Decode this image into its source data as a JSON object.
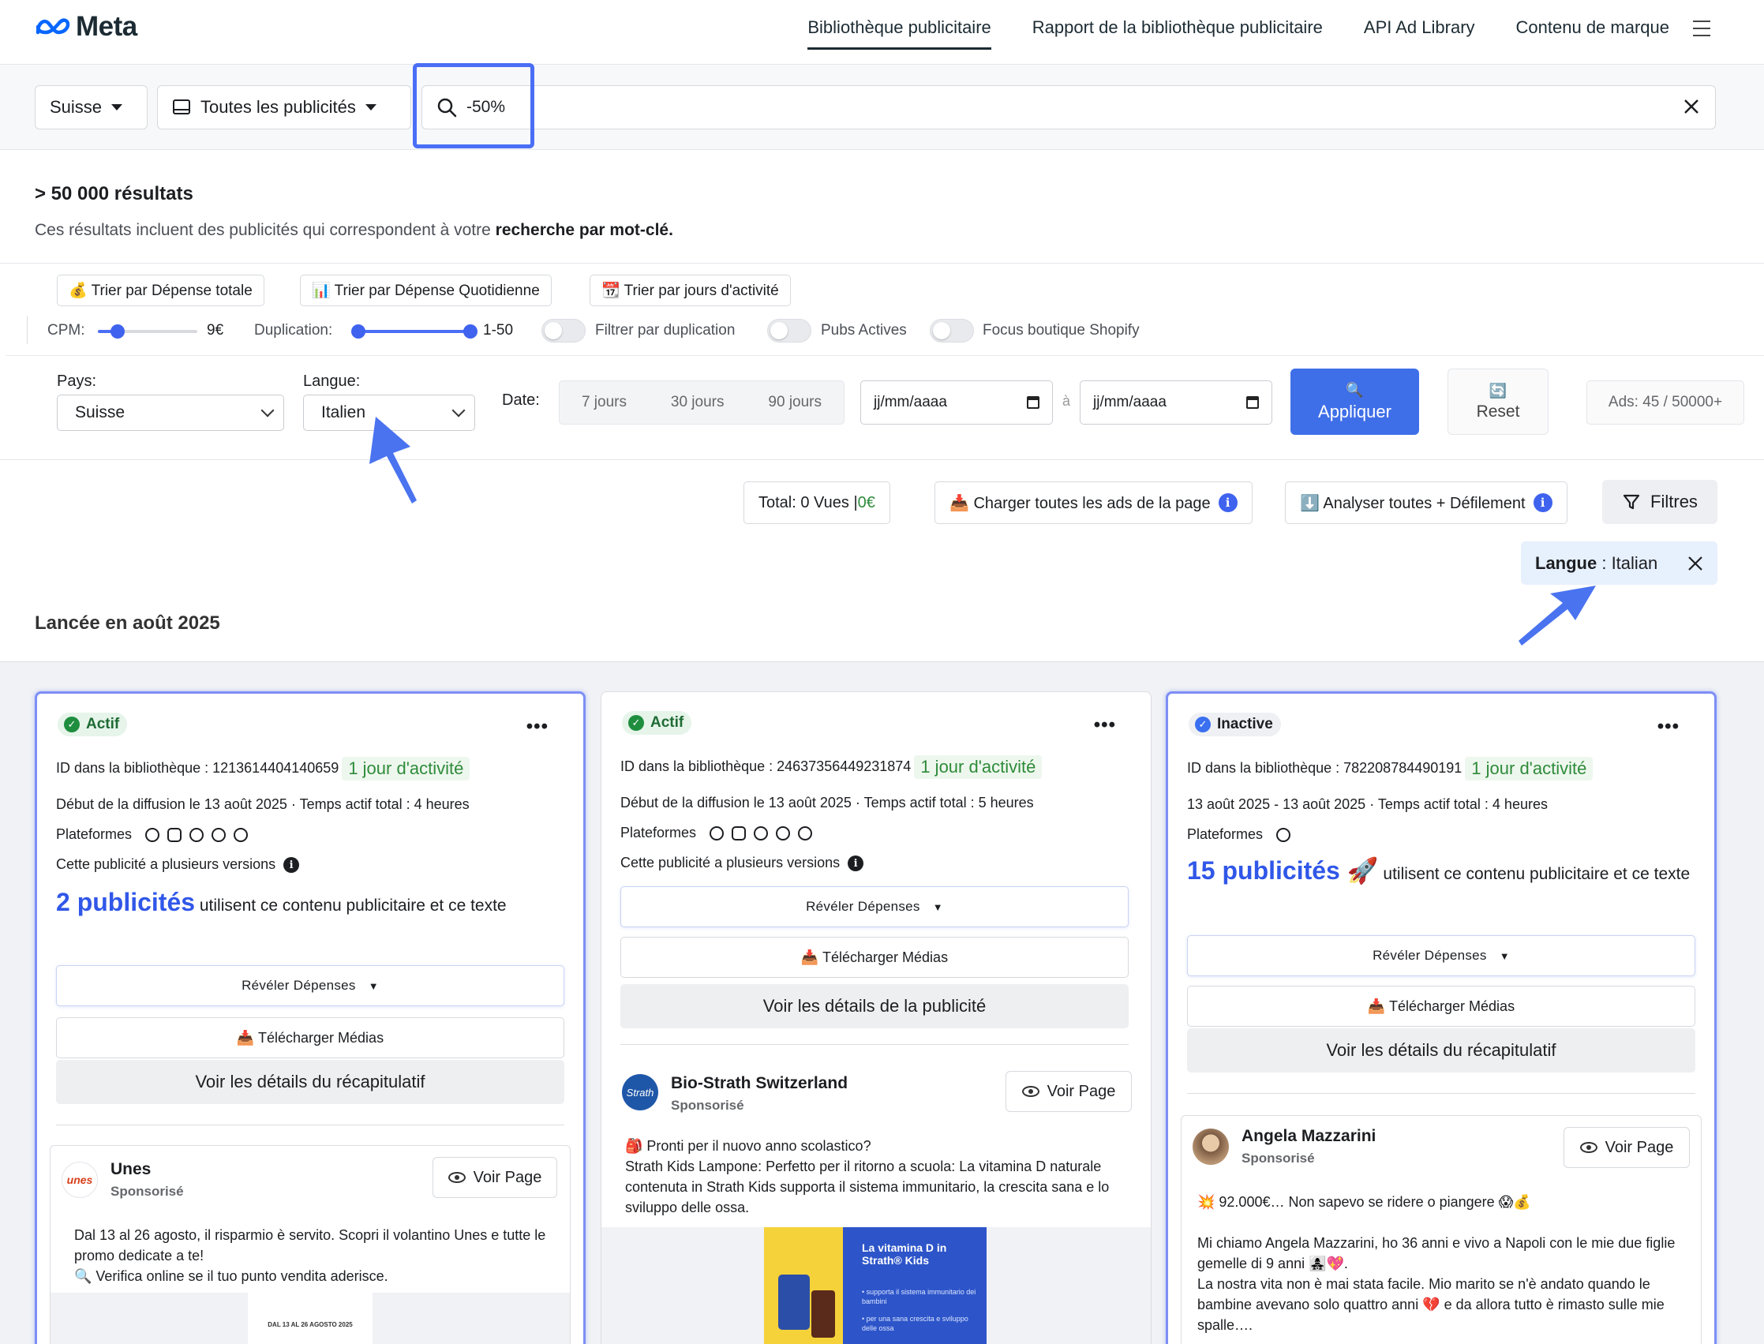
{
  "nav": {
    "logo": "Meta",
    "links": [
      "Bibliothèque publicitaire",
      "Rapport de la bibliothèque publicitaire",
      "API Ad Library",
      "Contenu de marque"
    ]
  },
  "search": {
    "country": "Suisse",
    "ad_type": "Toutes les publicités",
    "query": "-50%"
  },
  "results": {
    "count": "> 50 000 résultats",
    "desc_prefix": "Ces résultats incluent des publicités qui correspondent à votre ",
    "desc_bold": "recherche par mot-clé."
  },
  "sort": {
    "total": "💰 Trier par Dépense totale",
    "daily": "📊 Trier par Dépense Quotidienne",
    "days": "📆 Trier par jours d'activité"
  },
  "sliders": {
    "cpm_label": "CPM:",
    "cpm_value": "9€",
    "cpm_fraction": 0.2,
    "dup_label": "Duplication:",
    "dup_value": "1-50",
    "dup_range": [
      0,
      1
    ]
  },
  "toggles": {
    "dup": "Filtrer par duplication",
    "active": "Pubs Actives",
    "shopify": "Focus boutique Shopify"
  },
  "filters": {
    "pays_label": "Pays:",
    "pays_value": "Suisse",
    "langue_label": "Langue:",
    "langue_value": "Italien",
    "date_label": "Date:",
    "d7": "7 jours",
    "d30": "30 jours",
    "d90": "90 jours",
    "date_from": "jj/mm/aaaa",
    "date_sep": "à",
    "date_to": "jj/mm/aaaa",
    "apply": "Appliquer",
    "reset": "Reset",
    "ads_count": "Ads: 45 / 50000+"
  },
  "actions": {
    "total_prefix": "Total: 0 Vues | ",
    "total_money": "0€",
    "load_all": "📥 Charger toutes les ads de la page",
    "analyze": "⬇️ Analyser toutes + Défilement",
    "filters": "Filtres"
  },
  "chip": {
    "key": "Langue",
    "value": " : Italian"
  },
  "section_title": "Lancée en août 2025",
  "cards": [
    {
      "status": "Actif",
      "id_line": "ID dans la bibliothèque : 1213614404140659",
      "days": "1 jour d'activité",
      "run_line": "Début de la diffusion le 13 août 2025 · Temps actif total : 4 heures",
      "platforms_label": "Plateformes",
      "versions": "Cette publicité a plusieurs versions",
      "count_bold": "2 publicités",
      "count_rest": " utilisent ce contenu publicitaire et ce texte",
      "reveal": "Révéler Dépenses",
      "download": "📥 Télécharger Médias",
      "details": "Voir les détails du récapitulatif",
      "advertiser": "Unes",
      "avatar_text": "unes",
      "sponsored": "Sponsorisé",
      "voir_page": "Voir Page",
      "ad_text_1": "Dal 13 al 26 agosto, il risparmio è servito. Scopri il volantino Unes e tutte le promo dedicate a te!",
      "ad_text_2": "🔍 Verifica online se il tuo punto vendita aderisce.",
      "image_text": "DAL 13 AL 26 AGOSTO 2025"
    },
    {
      "status": "Actif",
      "id_line": "ID dans la bibliothèque : 24637356449231874",
      "days": "1 jour d'activité",
      "run_line": "Début de la diffusion le 13 août 2025 · Temps actif total : 5 heures",
      "platforms_label": "Plateformes",
      "versions": "Cette publicité a plusieurs versions",
      "reveal": "Révéler Dépenses",
      "download": "📥 Télécharger Médias",
      "details": "Voir les détails de la publicité",
      "advertiser": "Bio-Strath Switzerland",
      "avatar_text": "Strath",
      "sponsored": "Sponsorisé",
      "voir_page": "Voir Page",
      "ad_text_1": "🎒 Pronti per il nuovo anno scolastico?",
      "ad_text_2": "Strath Kids Lampone: Perfetto per il ritorno a scuola: La vitamina D naturale contenuta in Strath Kids supporta il sistema immunitario, la crescita sana e lo sviluppo delle ossa.",
      "image_title": "La vitamina D in Strath® Kids",
      "image_b1": "• supporta il sistema immunitario dei bambini",
      "image_b2": "• per una sana crescita e sviluppo delle ossa"
    },
    {
      "status": "Inactive",
      "id_line": "ID dans la bibliothèque : 782208784490191",
      "days": "1 jour d'activité",
      "run_line": "13 août 2025 - 13 août 2025 · Temps actif total : 4 heures",
      "platforms_label": "Plateformes",
      "count_bold": "15 publicités 🚀",
      "count_rest": " utilisent ce contenu publicitaire et ce texte",
      "reveal": "Révéler Dépenses",
      "download": "📥 Télécharger Médias",
      "details": "Voir les détails du récapitulatif",
      "advertiser": "Angela Mazzarini",
      "sponsored": "Sponsorisé",
      "voir_page": "Voir Page",
      "ad_text_1": "💥 92.000€… Non sapevo se ridere o piangere 😱💰",
      "ad_text_2": "Mi chiamo Angela Mazzarini, ho 36 anni e vivo a Napoli con le mie due figlie gemelle di 9 anni 👩‍👧‍👧💖.",
      "ad_text_3": "La nostra vita non è mai stata facile. Mio marito se n'è andato quando le bambine avevano solo quattro anni 💔 e da allora tutto è rimasto sulle mie spalle…."
    }
  ]
}
